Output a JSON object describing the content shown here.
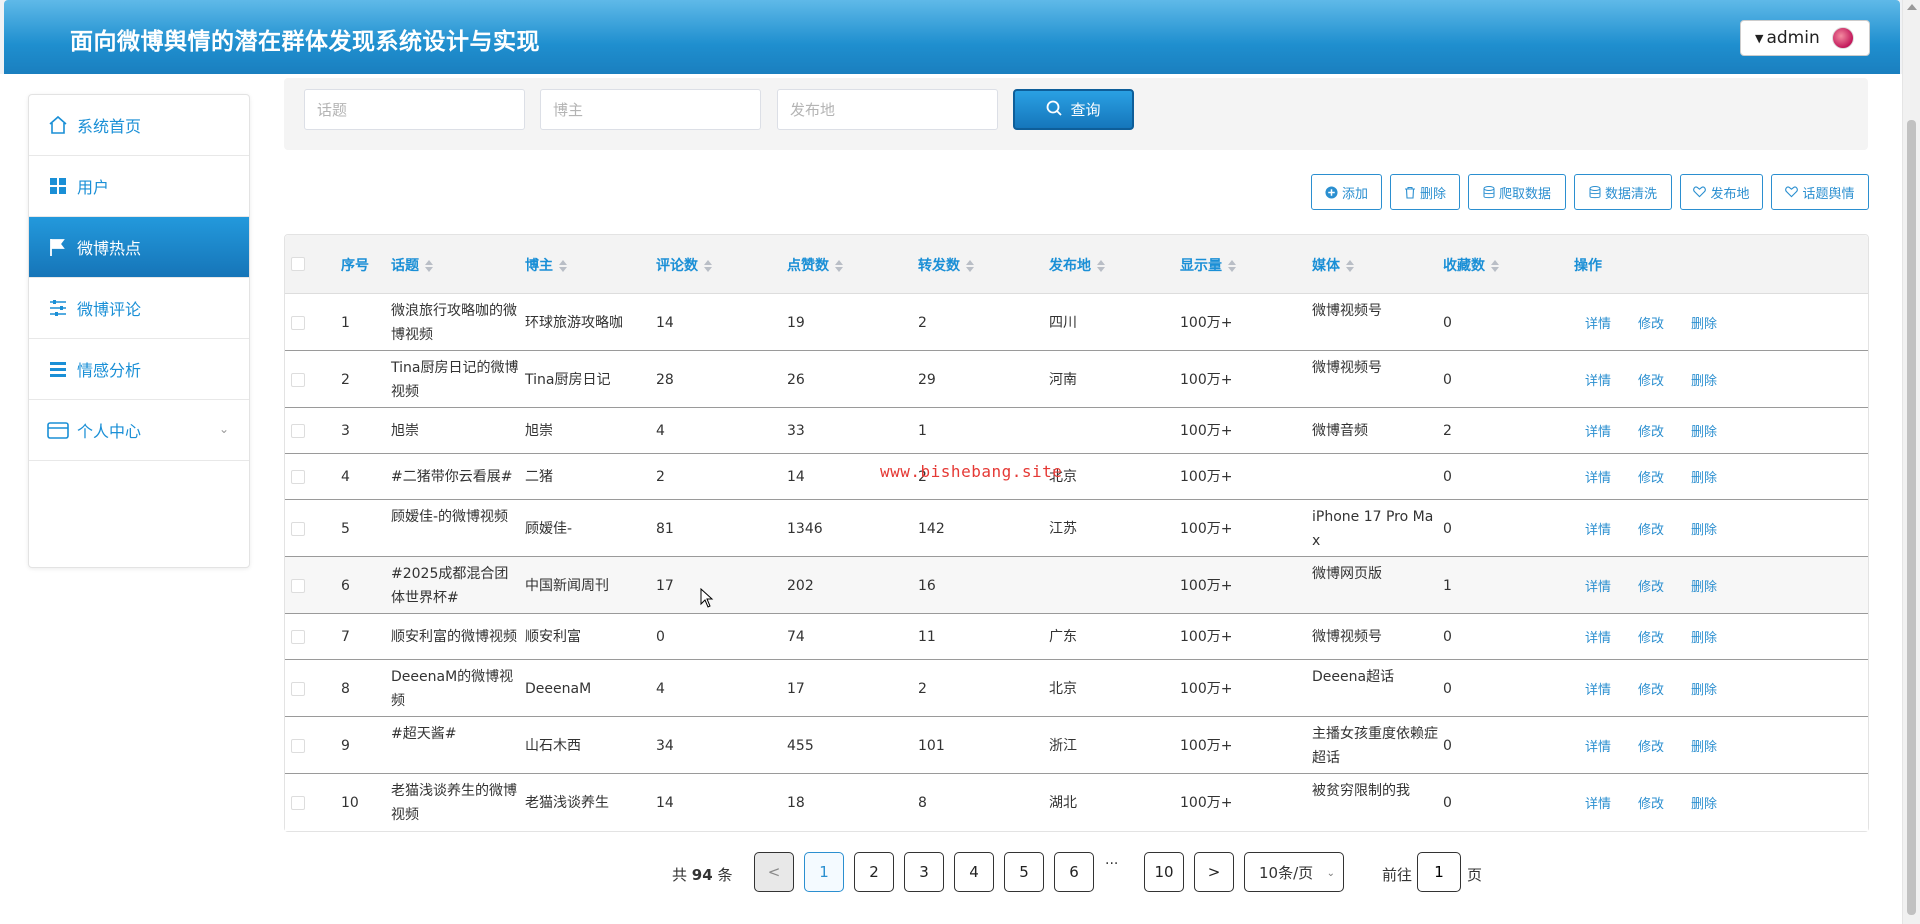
{
  "app": {
    "title": "面向微博舆情的潜在群体发现系统设计与实现",
    "username": "admin"
  },
  "sidebar": {
    "items": [
      {
        "label": "系统首页",
        "icon": "home-icon"
      },
      {
        "label": "用户",
        "icon": "grid-icon"
      },
      {
        "label": "微博热点",
        "icon": "flag-icon",
        "active": true
      },
      {
        "label": "微博评论",
        "icon": "sliders-icon"
      },
      {
        "label": "情感分析",
        "icon": "list-icon"
      },
      {
        "label": "个人中心",
        "icon": "wallet-icon",
        "has_submenu": true
      }
    ]
  },
  "search": {
    "topic_placeholder": "话题",
    "blogger_placeholder": "博主",
    "location_placeholder": "发布地",
    "query_label": "查询"
  },
  "toolbar": {
    "add": "添加",
    "delete": "删除",
    "crawl": "爬取数据",
    "clean": "数据清洗",
    "location": "发布地",
    "topic_sentiment": "话题舆情"
  },
  "table": {
    "headers": {
      "index": "序号",
      "topic": "话题",
      "blogger": "博主",
      "comments": "评论数",
      "likes": "点赞数",
      "reposts": "转发数",
      "location": "发布地",
      "views": "显示量",
      "media": "媒体",
      "favorites": "收藏数",
      "actions": "操作"
    },
    "actions": {
      "detail": "详情",
      "edit": "修改",
      "delete": "删除"
    },
    "rows": [
      {
        "index": "1",
        "topic": "微浪旅行攻略咖的微博视频",
        "blogger": "环球旅游攻略咖",
        "comments": "14",
        "likes": "19",
        "reposts": "2",
        "location": "四川",
        "views": "100万+",
        "media": "微博视频号",
        "favorites": "0"
      },
      {
        "index": "2",
        "topic": "Tina厨房日记的微博视频",
        "blogger": "Tina厨房日记",
        "comments": "28",
        "likes": "26",
        "reposts": "29",
        "location": "河南",
        "views": "100万+",
        "media": "微博视频号",
        "favorites": "0"
      },
      {
        "index": "3",
        "topic": "旭崇",
        "blogger": "旭崇",
        "comments": "4",
        "likes": "33",
        "reposts": "1",
        "location": "",
        "views": "100万+",
        "media": "微博音频",
        "favorites": "2"
      },
      {
        "index": "4",
        "topic": "#二猪带你云看展#",
        "blogger": "二猪",
        "comments": "2",
        "likes": "14",
        "reposts": "2",
        "location": "北京",
        "views": "100万+",
        "media": "",
        "favorites": "0"
      },
      {
        "index": "5",
        "topic": "顾嫒佳-的微博视频",
        "blogger": "顾嫒佳-",
        "comments": "81",
        "likes": "1346",
        "reposts": "142",
        "location": "江苏",
        "views": "100万+",
        "media": "iPhone 17 Pro Max",
        "favorites": "0"
      },
      {
        "index": "6",
        "topic": "#2025成都混合团体世界杯#",
        "blogger": "中国新闻周刊",
        "comments": "17",
        "likes": "202",
        "reposts": "16",
        "location": "",
        "views": "100万+",
        "media": "微博网页版",
        "favorites": "1"
      },
      {
        "index": "7",
        "topic": "顺安利富的微博视频",
        "blogger": "顺安利富",
        "comments": "0",
        "likes": "74",
        "reposts": "11",
        "location": "广东",
        "views": "100万+",
        "media": "微博视频号",
        "favorites": "0"
      },
      {
        "index": "8",
        "topic": "DeeenaM的微博视频",
        "blogger": "DeeenaM",
        "comments": "4",
        "likes": "17",
        "reposts": "2",
        "location": "北京",
        "views": "100万+",
        "media": "Deeena超话",
        "favorites": "0"
      },
      {
        "index": "9",
        "topic": "#超天酱#",
        "blogger": "山石木西",
        "comments": "34",
        "likes": "455",
        "reposts": "101",
        "location": "浙江",
        "views": "100万+",
        "media": "主播女孩重度依赖症超话",
        "favorites": "0"
      },
      {
        "index": "10",
        "topic": "老猫浅谈养生的微博视频",
        "blogger": "老猫浅谈养生",
        "comments": "14",
        "likes": "18",
        "reposts": "8",
        "location": "湖北",
        "views": "100万+",
        "media": "被贫穷限制的我",
        "favorites": "0"
      }
    ]
  },
  "pagination": {
    "total_prefix": "共",
    "total": "94",
    "total_suffix": "条",
    "prev": "<",
    "next": ">",
    "pages": [
      "1",
      "2",
      "3",
      "4",
      "5",
      "6"
    ],
    "ellipsis": "···",
    "last_page": "10",
    "current": "1",
    "page_size": "10条/页",
    "goto_prefix": "前往",
    "goto_value": "1",
    "goto_suffix": "页"
  },
  "watermark": "www.bishebang.site"
}
